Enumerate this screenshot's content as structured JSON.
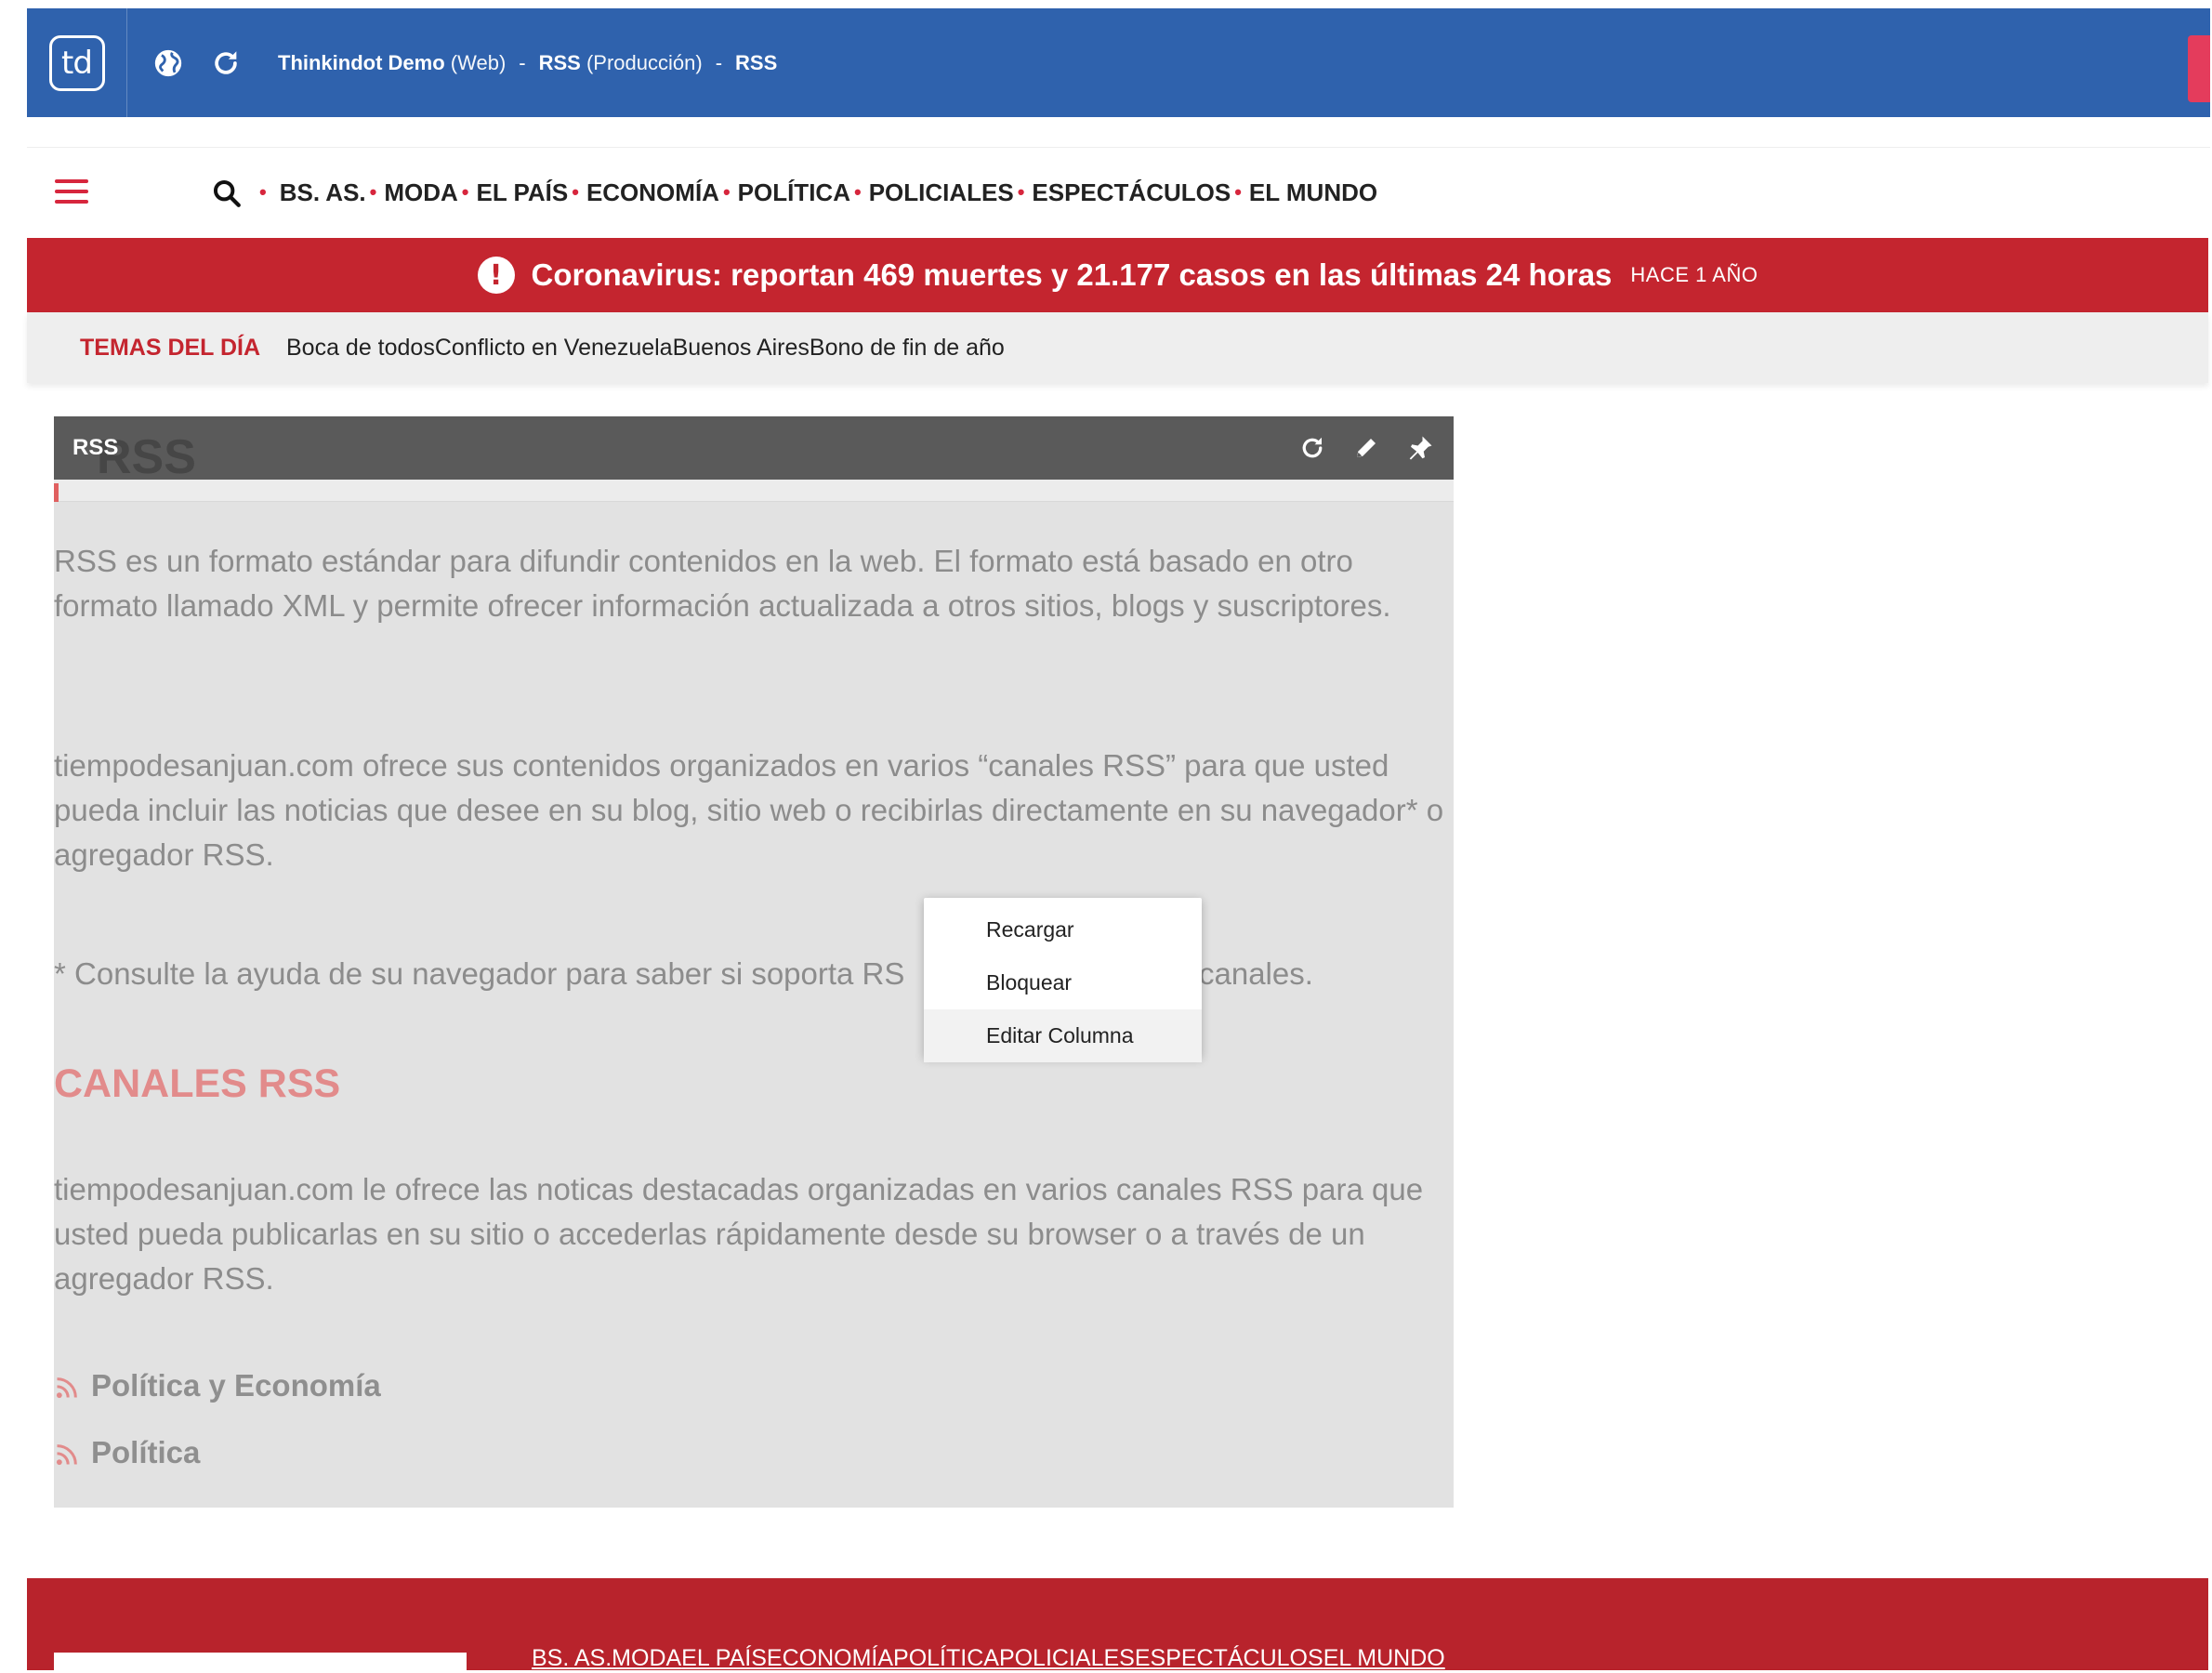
{
  "app": {
    "logo_text": "td",
    "breadcrumb": [
      {
        "name": "Thinkindot Demo",
        "suffix": "(Web)"
      },
      {
        "name": "RSS",
        "suffix": "(Producción)"
      },
      {
        "name": "RSS",
        "suffix": ""
      }
    ],
    "separator": "-",
    "accent_color": "#2f62ad"
  },
  "nav": {
    "items": [
      "BS. AS.",
      "MODA",
      "EL PAÍS",
      "ECONOMÍA",
      "POLÍTICA",
      "POLICIALES",
      "ESPECTÁCULOS",
      "EL MUNDO"
    ],
    "dot": "•"
  },
  "alert": {
    "icon": "!",
    "text": "Coronavirus: reportan 469 muertes y 21.177 casos en las últimas 24 horas",
    "time": "HACE 1 AÑO",
    "color": "#c4252f"
  },
  "temas": {
    "label": "TEMAS DEL DÍA",
    "items": [
      "Boca de todos",
      "Conflicto en Venezuela",
      "Buenos Aires",
      "Bono de fin de año"
    ]
  },
  "panel": {
    "title": "RSS",
    "ghost_title": "RSS",
    "paragraph1": "RSS es un formato estándar para difundir contenidos en la web. El formato está basado en otro formato llamado XML y permite ofrecer información actualizada a otros sitios, blogs y suscriptores.",
    "paragraph2": "tiempodesanjuan.com ofrece sus contenidos organizados en varios “canales RSS” para que usted pueda incluir las noticias que desee en su blog, sitio web o recibirlas directamente en su navegador* o agregador RSS.",
    "paragraph3_left": "* Consulte la ayuda de su navegador para saber si soporta RS",
    "paragraph3_right": "canales.",
    "heading": "CANALES RSS",
    "paragraph4": "tiempodesanjuan.com le ofrece las noticas destacadas organizadas en varios canales RSS para que usted pueda publicarlas en su sitio o accederlas rápidamente desde su browser o a través de un agregador RSS.",
    "links": [
      "Política y Economía",
      "Política"
    ]
  },
  "context_menu": {
    "items": [
      "Recargar",
      "Bloquear",
      "Editar Columna"
    ]
  },
  "footer": {
    "nav": [
      "BS. AS.",
      "MODA",
      "EL PAÍS",
      "ECONOMÍA",
      "POLÍTICA",
      "POLICIALES",
      "ESPECTÁCULOS",
      "EL MUNDO"
    ],
    "color": "#b8232c"
  },
  "icons": {
    "globe": "globe-icon",
    "reload": "reload-icon",
    "search": "search-icon",
    "menu": "hamburger-icon",
    "edit": "pencil-icon",
    "pin": "pin-icon",
    "rss": "rss-icon",
    "alert": "alert-icon"
  }
}
